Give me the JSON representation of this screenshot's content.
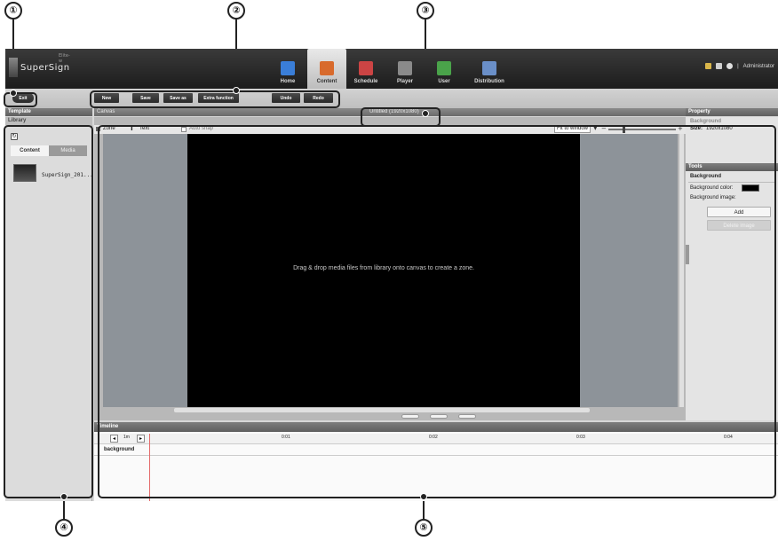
{
  "app": {
    "brand": "SuperSign",
    "brand_sub": "Elite-w",
    "user": "Administrator"
  },
  "nav": [
    {
      "label": "Home",
      "icon": "home-icon",
      "color": "#3a7ed8",
      "active": false
    },
    {
      "label": "Content",
      "icon": "clapperboard-icon",
      "color": "#d86a2c",
      "active": true
    },
    {
      "label": "Schedule",
      "icon": "calendar-icon",
      "color": "#cc4444",
      "active": false
    },
    {
      "label": "Player",
      "icon": "player-icon",
      "color": "#8a8a8a",
      "active": false
    },
    {
      "label": "User",
      "icon": "user-icon",
      "color": "#4aa34a",
      "active": false
    },
    {
      "label": "Distribution",
      "icon": "distribution-icon",
      "color": "#6a8fc8",
      "active": false
    }
  ],
  "toolbar": {
    "exit": "Exit",
    "new": "New",
    "save": "Save",
    "save_as": "Save as",
    "extra": "Extra function",
    "undo": "Undo",
    "redo": "Redo"
  },
  "panels": {
    "template": "Template",
    "library": "Library",
    "canvas": "Canvas",
    "doc_title": "Untitled (1920x1080)",
    "property": "Property",
    "timeline": "Timeline"
  },
  "library": {
    "tabs": [
      "Content",
      "Media"
    ],
    "item": "SuperSign_201..."
  },
  "canvas": {
    "zone": "Zone",
    "text": "Text",
    "auto_snap": "Auto snap",
    "fit": "Fit to window",
    "message": "Drag & drop media files from library onto canvas to create a zone."
  },
  "property": {
    "section": "Background",
    "size_label": "Size:",
    "size_value": "1920x1080",
    "tools": "Tools",
    "tools_section": "Background",
    "bg_color": "Background color:",
    "bg_image": "Background image:",
    "add": "Add",
    "delete_image": "Delete image",
    "bg_color_swatch": "#000000"
  },
  "timeline": {
    "step": "1m",
    "ticks": [
      "0:01",
      "0:02",
      "0:03",
      "0:04"
    ],
    "row": "background"
  },
  "callouts": [
    "①",
    "②",
    "③",
    "④",
    "⑤"
  ]
}
